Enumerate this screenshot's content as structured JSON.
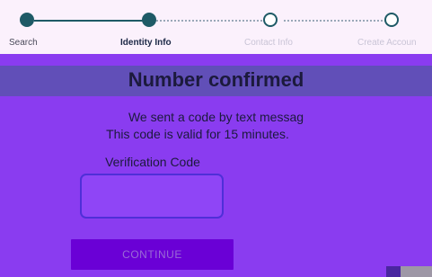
{
  "stepper": {
    "steps": [
      {
        "label": "Search",
        "state": "done"
      },
      {
        "label": "Identity Info",
        "state": "current"
      },
      {
        "label": "Contact Info",
        "state": "todo"
      },
      {
        "label": "Create Accoun",
        "state": "todo"
      }
    ]
  },
  "main": {
    "heading": "Number confirmed",
    "message_line1": "We sent a code by text messag",
    "message_line2": "This code is valid for 15 minutes.",
    "code_label": "Verification Code",
    "code_value": "",
    "continue_label": "CONTINUE"
  },
  "colors": {
    "background": "#8a3cf0",
    "stepper_bg": "#fbf1fc",
    "step_accent": "#1e5a66",
    "heading_band": "#614fb8",
    "input_border": "#4f2fd8",
    "button_bg": "#6a00d6"
  }
}
